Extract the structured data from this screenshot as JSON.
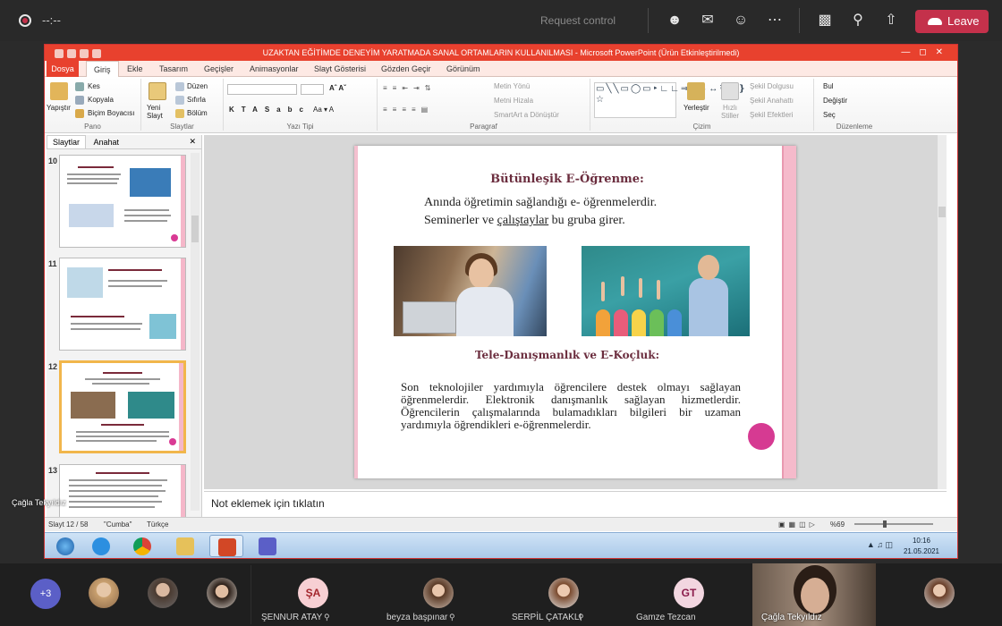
{
  "teams_bar": {
    "timer": "--:--",
    "request_control": "Request control",
    "leave_label": "Leave"
  },
  "powerpoint": {
    "window_title": "UZAKTAN EĞİTİMDE DENEYİM YARATMADA SANAL ORTAMLARIN KULLANILMASI  -  Microsoft PowerPoint (Ürün Etkinleştirilmedi)",
    "tabs": [
      "Dosya",
      "Giriş",
      "Ekle",
      "Tasarım",
      "Geçişler",
      "Animasyonlar",
      "Slayt Gösterisi",
      "Gözden Geçir",
      "Görünüm"
    ],
    "ribbon": {
      "clipboard": {
        "paste": "Yapıştır",
        "cut": "Kes",
        "copy": "Kopyala",
        "format_painter": "Biçim Boyacısı",
        "label": "Pano"
      },
      "slides": {
        "new_slide": "Yeni Slayt",
        "layout": "Düzen",
        "reset": "Sıfırla",
        "section": "Bölüm",
        "label": "Slaytlar"
      },
      "font": {
        "label": "Yazı Tipi"
      },
      "paragraph": {
        "text_direction": "Metin Yönü",
        "align_text": "Metni Hizala",
        "smartart": "SmartArt a Dönüştür",
        "label": "Paragraf"
      },
      "drawing": {
        "arrange": "Yerleştir",
        "quick_styles": "Hızlı Stiller",
        "shape_outline": "Şekil Dolgusu",
        "shape_effects_a": "Şekil Anahattı",
        "shape_effects_b": "Şekil Efektleri",
        "label": "Çizim"
      },
      "editing": {
        "find": "Bul",
        "replace": "Değiştir",
        "select": "Seç",
        "label": "Düzenleme"
      }
    },
    "panel_tabs": {
      "slides": "Slaytlar",
      "outline": "Anahat"
    },
    "thumbnails": [
      {
        "number": "10"
      },
      {
        "number": "11"
      },
      {
        "number": "12"
      },
      {
        "number": "13"
      }
    ],
    "slide": {
      "title": "Bütünleşik E-Öğrenme:",
      "line1": "Anında öğretimin sağlandığı e- öğrenmelerdir.",
      "line2a": "Seminerler ve ",
      "line2b": "çalıştaylar",
      "line2c": " bu gruba girer.",
      "subtitle": "Tele-Danışmanlık ve E-Koçluk:",
      "paragraph": "Son teknolojiler yardımıyla öğrencilere destek olmayı sağlayan öğrenmelerdir. Elektronik danışmanlık sağlayan hizmetlerdir. Öğrencilerin çalışmalarında bulamadıkları bilgileri bir uzaman yardımıyla öğrendikleri e-öğrenmelerdir."
    },
    "notes_placeholder": "Not eklemek için tıklatın",
    "status": {
      "slide": "Slayt 12 / 58",
      "theme": "\"Cumba\"",
      "language": "Türkçe",
      "zoom": "%69"
    },
    "clock": {
      "time": "10:16",
      "date": "21.05.2021"
    }
  },
  "presenter_name": "Çağla Tekyıldız",
  "participants": {
    "more": "+3",
    "people": [
      {
        "initials": "ŞA",
        "name": "ŞENNUR ATAY"
      },
      {
        "initials": "",
        "name": "beyza başpınar"
      },
      {
        "initials": "",
        "name": "SERPİL ÇATAKLI"
      },
      {
        "initials": "GT",
        "name": "Gamze Tezcan"
      }
    ],
    "camera_name": "Çağla Tekyıldız"
  },
  "colors": {
    "leave": "#c4314b",
    "ppt_accent": "#e8412e",
    "slide_heading": "#6b2d3e",
    "slide_dot": "#d63a92"
  }
}
